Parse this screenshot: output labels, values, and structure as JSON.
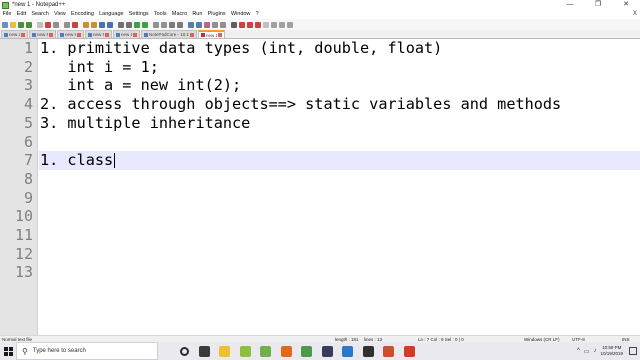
{
  "window": {
    "title": "*new 1 - Notepad++",
    "controls": [
      "—",
      "❐",
      "✕"
    ]
  },
  "menu": [
    "File",
    "Edit",
    "Search",
    "View",
    "Encoding",
    "Language",
    "Settings",
    "Tools",
    "Macro",
    "Run",
    "Plugins",
    "Window",
    "?"
  ],
  "menu_close": "X",
  "toolbar_icon_colors": [
    "#6a8ec8",
    "#e8c040",
    "#4a8f3a",
    "#4a8f3a",
    "#c0c0c0",
    "#d04040",
    "#909090",
    "#909090",
    "#c84040",
    "#c89030",
    "#c89030",
    "#4a70b0",
    "#4a70b0",
    "#707070",
    "#707070",
    "#40a040",
    "#40a040",
    "#909090",
    "#909090",
    "#7a7a7a",
    "#7a7a7a",
    "#5a7ab0",
    "#5a7ab0",
    "#c06090",
    "#909090",
    "#909090",
    "#606060",
    "#d04040",
    "#d04040",
    "#d04040",
    "#c0c0c0",
    "#a0a0a0",
    "#a0a0a0",
    "#a0a0a0"
  ],
  "tabs": [
    {
      "label": "new 2",
      "active": false
    },
    {
      "label": "new 6",
      "active": false
    },
    {
      "label": "new 8",
      "active": false
    },
    {
      "label": "new 9",
      "active": false
    },
    {
      "label": "new 10",
      "active": false
    },
    {
      "label": "NotePadCore - 10.10.19",
      "active": false
    },
    {
      "label": "new 1",
      "active": true
    }
  ],
  "editor": {
    "line_numbers": [
      "1",
      "2",
      "3",
      "4",
      "5",
      "6",
      "7",
      "8",
      "9",
      "10",
      "11",
      "12",
      "13"
    ],
    "lines": [
      "1. primitive data types (int, double, float)",
      "   int i = 1;",
      "   int a = new int(2);",
      "2. access through objects==> static variables and methods",
      "3. multiple inheritance",
      "",
      "1. class",
      "",
      "",
      "",
      "",
      "",
      ""
    ],
    "current_line": 7
  },
  "status": {
    "file_type": "Normal text file",
    "length": "length : 181",
    "lines": "lines : 13",
    "position": "Ln : 7   Col : 9   Sel : 0 | 0",
    "eol": "Windows (CR LF)",
    "encoding": "UTF-8",
    "mode": "INS"
  },
  "taskbar": {
    "search_placeholder": "Type here to search",
    "search_icon": "⚲",
    "app_icons": [
      {
        "name": "cortana-icon",
        "color": "#2b2b2b"
      },
      {
        "name": "task-view-icon",
        "color": "#3a3a3a"
      },
      {
        "name": "file-explorer-icon",
        "color": "#f0c030"
      },
      {
        "name": "photos-icon",
        "color": "#8fbf3f"
      },
      {
        "name": "notepadpp-icon",
        "color": "#6fb04a"
      },
      {
        "name": "firefox-icon",
        "color": "#e06a1a"
      },
      {
        "name": "chrome-icon",
        "color": "#4a9a4a"
      },
      {
        "name": "media-icon",
        "color": "#3a3a5a"
      },
      {
        "name": "store-icon",
        "color": "#2a78c8"
      },
      {
        "name": "terminal-icon",
        "color": "#303030"
      },
      {
        "name": "powerpoint-icon",
        "color": "#c8502a"
      },
      {
        "name": "app-red-icon",
        "color": "#d43a2a"
      }
    ],
    "tray_glyphs": [
      "^",
      "▭",
      "♪"
    ],
    "time": "10:59 PM",
    "date": "10/19/2019"
  }
}
